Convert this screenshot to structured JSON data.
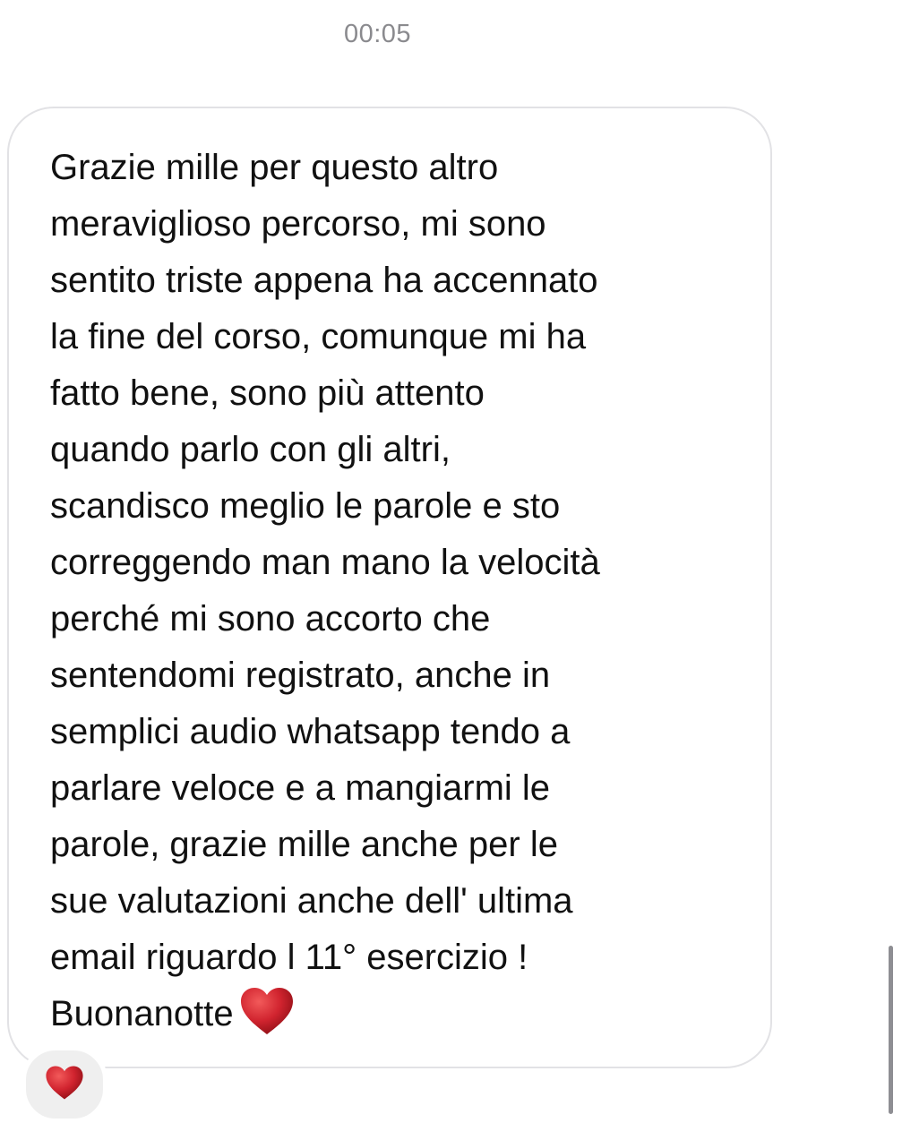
{
  "chat": {
    "timestamp": "00:05",
    "message": {
      "text": "Grazie mille per questo altro\nmeraviglioso percorso, mi sono\nsentito triste appena ha accennato\nla fine del corso, comunque mi ha\nfatto bene, sono più attento\nquando parlo con gli altri,\nscandisco meglio le parole e sto\ncorreggendo man mano la velocità\nperché mi sono accorto che\nsentendomi registrato, anche in\nsemplici audio whatsapp tendo a\nparlare veloce e a mangiarmi le\nparole, grazie mille anche per le\nsue valutazioni anche dell' ultima\nemail riguardo l 11° esercizio !\nBuonanotte",
      "trailing_emoji": "red-heart-icon",
      "reaction": "red-heart-icon"
    }
  },
  "colors": {
    "bubble_border": "#e2e2e5",
    "timestamp": "#8a8a8e",
    "heart": "#d1242f",
    "reaction_bg": "#efefef"
  }
}
